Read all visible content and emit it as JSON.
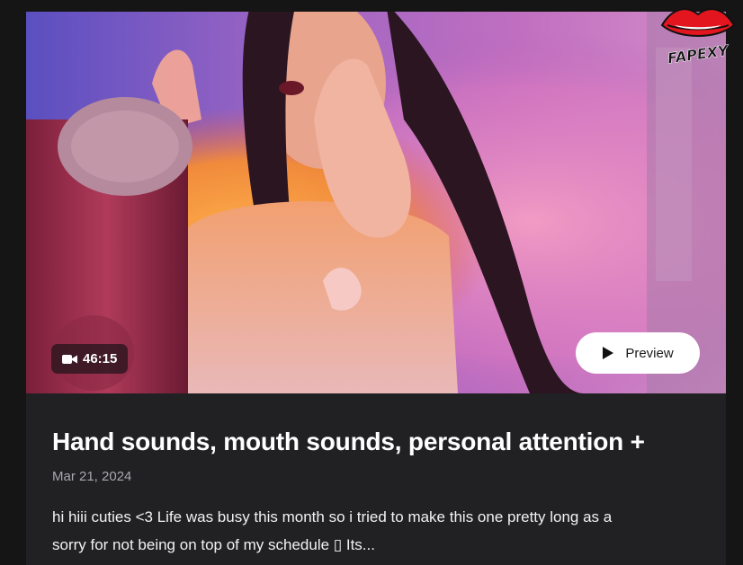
{
  "post": {
    "duration": "46:15",
    "preview_label": "Preview",
    "title": "Hand sounds, mouth sounds, personal attention +",
    "date": "Mar 21, 2024",
    "description_line1": "hi hiii cuties <3 Life was busy this month so i tried to make this one pretty long as a",
    "description_line2": "sorry for not being on top of my schedule ▯ Its..."
  },
  "logo": {
    "text": "FAPEXY",
    "icon": "lips-icon",
    "color": "#e3161f"
  },
  "icons": {
    "duration": "video-camera-icon",
    "preview": "play-icon"
  },
  "colors": {
    "card_bg": "#212124",
    "page_bg": "#151515",
    "button_bg": "#ffffff"
  }
}
